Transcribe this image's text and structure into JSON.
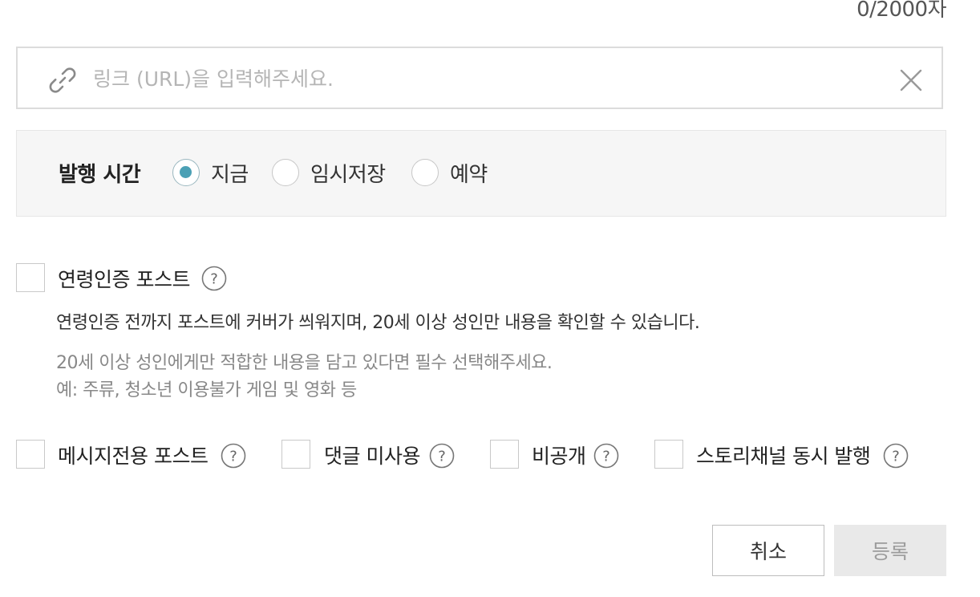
{
  "char_count": "0/2000자",
  "url_input": {
    "placeholder": "링크 (URL)을 입력해주세요.",
    "value": "",
    "icon": "link-icon",
    "clear_icon": "close-icon"
  },
  "publish_time": {
    "label": "발행 시간",
    "options": [
      {
        "label": "지금",
        "selected": true
      },
      {
        "label": "임시저장",
        "selected": false
      },
      {
        "label": "예약",
        "selected": false
      }
    ],
    "accent_color": "#4ba0b5"
  },
  "age_verify": {
    "label": "연령인증 포스트",
    "checked": false,
    "description": "연령인증 전까지 포스트에 커버가 씌워지며, 20세 이상 성인만 내용을 확인할 수 있습니다.",
    "note_line1": "20세 이상 성인에게만 적합한 내용을 담고 있다면 필수 선택해주세요.",
    "note_line2": "예: 주류, 청소년 이용불가 게임 및 영화 등"
  },
  "options": [
    {
      "label": "메시지전용 포스트",
      "checked": false
    },
    {
      "label": "댓글 미사용",
      "checked": false
    },
    {
      "label": "비공개",
      "checked": false
    },
    {
      "label": "스토리채널 동시 발행",
      "checked": false
    }
  ],
  "buttons": {
    "cancel_label": "취소",
    "submit_label": "등록"
  }
}
